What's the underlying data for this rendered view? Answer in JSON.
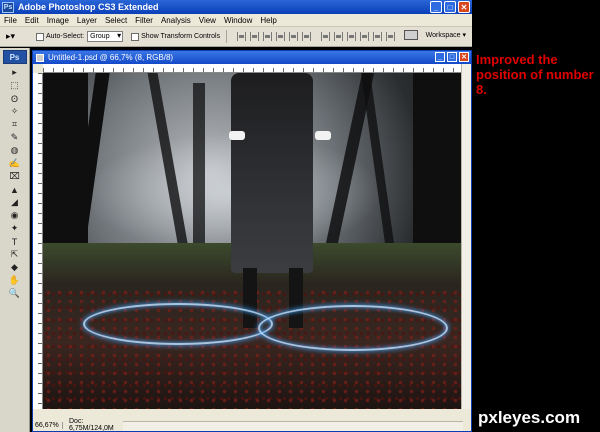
{
  "app": {
    "title": "Adobe Photoshop CS3 Extended",
    "icon": "Ps"
  },
  "window_controls": {
    "minimize": "_",
    "maximize": "□",
    "close": "✕"
  },
  "menu": [
    "File",
    "Edit",
    "Image",
    "Layer",
    "Select",
    "Filter",
    "Analysis",
    "View",
    "Window",
    "Help"
  ],
  "options_bar": {
    "auto_select_label": "Auto-Select:",
    "auto_select_value": "Group",
    "show_transform_label": "Show Transform Controls",
    "workspace_label": "Workspace ▾"
  },
  "tools": {
    "logo": "Ps",
    "items": [
      "▸",
      "⬚",
      "ʘ",
      "✧",
      "⌗",
      "✎",
      "◍",
      "✍",
      "⌧",
      "▲",
      "◢",
      "◉",
      "✦",
      "T",
      "⇱",
      "◆",
      "✋",
      "🔍"
    ]
  },
  "document": {
    "title": "Untitled-1.psd @ 66,7% (8, RGB/8)",
    "zoom": "66,67%",
    "doc_info": "Doc: 6,75M/124,0M"
  },
  "annotation": {
    "text": "Improved the position of number 8."
  },
  "brand": {
    "text": "pxleyes.com"
  },
  "colors": {
    "annotation": "#e00000",
    "titlebar": "#0a3fb8"
  }
}
